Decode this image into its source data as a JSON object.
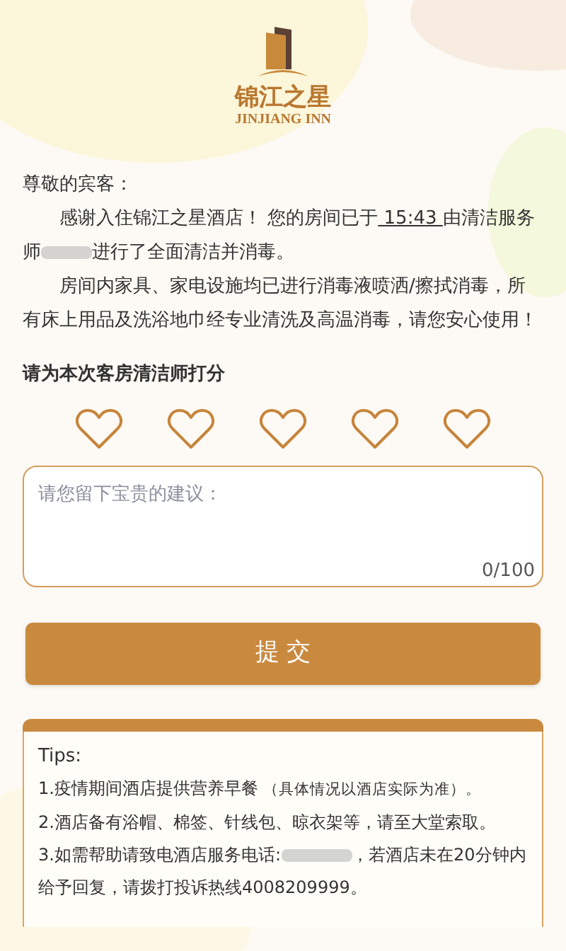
{
  "brand": {
    "name": "锦江之星",
    "name_en": "JINJIANG INN"
  },
  "letter": {
    "greeting": "尊敬的宾客：",
    "thanks_lead": "感谢入住锦江之星酒店！ 您的房间已于",
    "time": "15:43",
    "thanks_middle": "由清洁服务师",
    "thanks_tail": "进行了全面清洁并消毒。",
    "assurance": "房间内家具、家电设施均已进行消毒液喷洒/擦拭消毒，所有床上用品及洗浴地巾经专业清洗及高温消毒，请您安心使用！"
  },
  "rating": {
    "title": "请为本次客房清洁师打分",
    "stars": 0
  },
  "suggestion": {
    "placeholder": "请您留下宝贵的建议：",
    "counter": "0/100"
  },
  "submit": {
    "label": "提 交"
  },
  "tips": {
    "title": "Tips:",
    "items": [
      {
        "text": "1.疫情期间酒店提供营养早餐",
        "note": "（具体情况以酒店实际为准）。"
      },
      {
        "text": "2.酒店备有浴帽、棉签、针线包、晾衣架等，请至大堂索取。"
      },
      {
        "text": "3.如需帮助请致电酒店服务电话:",
        "redacted": true,
        "tail": "，若酒店未在20分钟内给予回复，请拨打投诉热线4008209999。"
      }
    ]
  }
}
